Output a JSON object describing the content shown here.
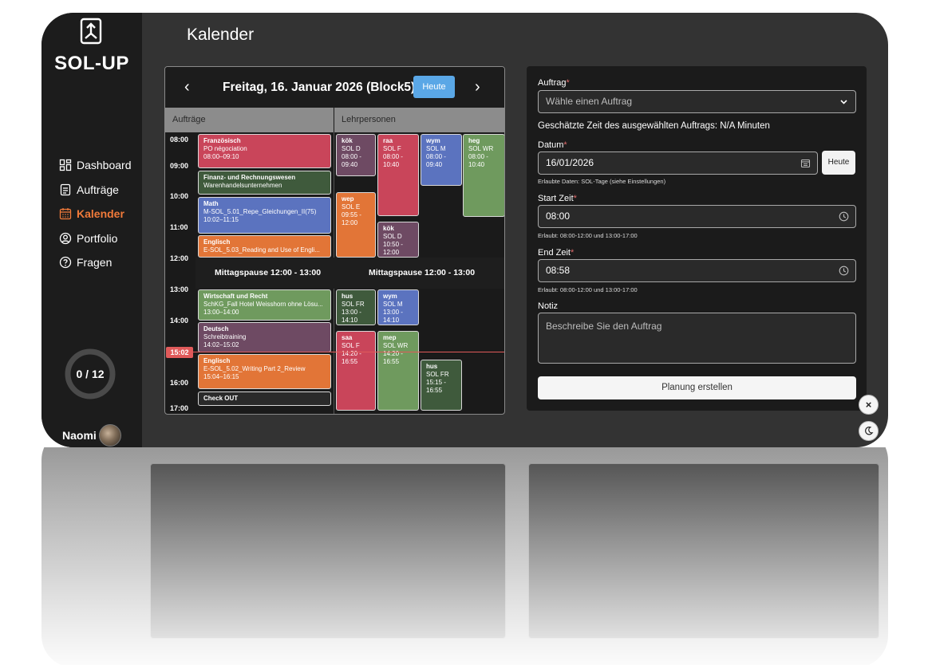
{
  "app": {
    "logo_text": "SOL-UP",
    "page_title": "Kalender"
  },
  "sidebar": {
    "items": [
      {
        "label": "Dashboard",
        "icon": "dashboard-icon"
      },
      {
        "label": "Aufträge",
        "icon": "clipboard-icon"
      },
      {
        "label": "Kalender",
        "icon": "calendar-icon",
        "active": true
      },
      {
        "label": "Portfolio",
        "icon": "user-circle-icon"
      },
      {
        "label": "Fragen",
        "icon": "question-circle-icon"
      }
    ],
    "progress": "0 / 12",
    "user_name": "Naomi"
  },
  "calendar": {
    "date_title": "Freitag, 16. Januar 2026 (Block5)",
    "today_label": "Heute",
    "prev_label": "‹",
    "next_label": "›",
    "columns": {
      "left": "Aufträge",
      "right": "Lehrpersonen"
    },
    "times": [
      "08:00",
      "09:00",
      "10:00",
      "11:00",
      "12:00",
      "13:00",
      "14:00",
      "15:02",
      "16:00",
      "17:00"
    ],
    "now_label": "15:02",
    "lunch_left": "Mittagspause 12:00 - 13:00",
    "lunch_right": "Mittagspause 12:00 - 13:00",
    "auftraege": [
      {
        "title": "Französisch",
        "l1": "PO négociation",
        "l2": "08:00–09:10",
        "color": "#c9455a"
      },
      {
        "title": "Finanz- und Rechnungswesen",
        "l1": "Warenhandelsunternehmen",
        "l2": "",
        "color": "#3f5a3c"
      },
      {
        "title": "Math",
        "l1": "M-SOL_5.01_Repe_Gleichungen_II(75)",
        "l2": "10:02–11:15",
        "color": "#5b73bf"
      },
      {
        "title": "Englisch",
        "l1": "E-SOL_5.03_Reading and Use of Engli...",
        "l2": "",
        "color": "#e27537"
      },
      {
        "title": "Wirtschaft und Recht",
        "l1": "SchKG_Fall Hotel Weisshorn ohne Lösu...",
        "l2": "13:00–14:00",
        "color": "#6f9a5e"
      },
      {
        "title": "Deutsch",
        "l1": "Schreibtraining",
        "l2": "14:02–15:02",
        "color": "#6e4a63"
      },
      {
        "title": "Englisch",
        "l1": "E-SOL_5.02_Writing Part 2_Review",
        "l2": "15:04–16:15",
        "color": "#e27537"
      },
      {
        "title": "Check OUT",
        "l1": "",
        "l2": "",
        "color": "#2a2a2a"
      }
    ],
    "lehrpersonen": [
      {
        "title": "kök",
        "l1": "SOL D",
        "l2": "08:00 -",
        "l3": "09:40",
        "color": "#6e4a63"
      },
      {
        "title": "raa",
        "l1": "SOL F",
        "l2": "08:00 -",
        "l3": "10:40",
        "color": "#c9455a"
      },
      {
        "title": "wym",
        "l1": "SOL M",
        "l2": "08:00 -",
        "l3": "09:40",
        "color": "#5b73bf"
      },
      {
        "title": "heg",
        "l1": "SOL WR",
        "l2": "08:00 -",
        "l3": "10:40",
        "color": "#6f9a5e"
      },
      {
        "title": "wep",
        "l1": "SOL E",
        "l2": "09:55 -",
        "l3": "12:00",
        "color": "#e27537"
      },
      {
        "title": "kök",
        "l1": "SOL D",
        "l2": "10:50 -",
        "l3": "12:00",
        "color": "#6e4a63"
      },
      {
        "title": "hus",
        "l1": "SOL FR",
        "l2": "13:00 -",
        "l3": "14:10",
        "color": "#3f5a3c"
      },
      {
        "title": "wym",
        "l1": "SOL M",
        "l2": "13:00 -",
        "l3": "14:10",
        "color": "#5b73bf"
      },
      {
        "title": "saa",
        "l1": "SOL F",
        "l2": "14:20 -",
        "l3": "16:55",
        "color": "#c9455a"
      },
      {
        "title": "mep",
        "l1": "SOL WR",
        "l2": "14:20 -",
        "l3": "16:55",
        "color": "#6f9a5e"
      },
      {
        "title": "hus",
        "l1": "SOL FR",
        "l2": "15:15 -",
        "l3": "16:55",
        "color": "#3f5a3c"
      }
    ]
  },
  "form": {
    "auftrag_label": "Auftrag",
    "auftrag_placeholder": "Wähle einen Auftrag",
    "estimate": "Geschätzte Zeit des ausgewählten Auftrags: N/A Minuten",
    "datum_label": "Datum",
    "datum_value": "16/01/2026",
    "datum_today": "Heute",
    "datum_hint": "Erlaubte Daten: SOL-Tage (siehe Einstellungen)",
    "start_label": "Start Zeit",
    "start_value": "08:00",
    "start_hint": "Erlaubt: 08:00-12:00 und 13:00-17:00",
    "end_label": "End Zeit",
    "end_value": "08:58",
    "end_hint": "Erlaubt: 08:00-12:00 und 13:00-17:00",
    "notiz_label": "Notiz",
    "notiz_placeholder": "Beschreibe Sie den Auftrag",
    "submit_label": "Planung erstellen",
    "required_mark": "*"
  },
  "floating": {
    "close_label": "×"
  }
}
